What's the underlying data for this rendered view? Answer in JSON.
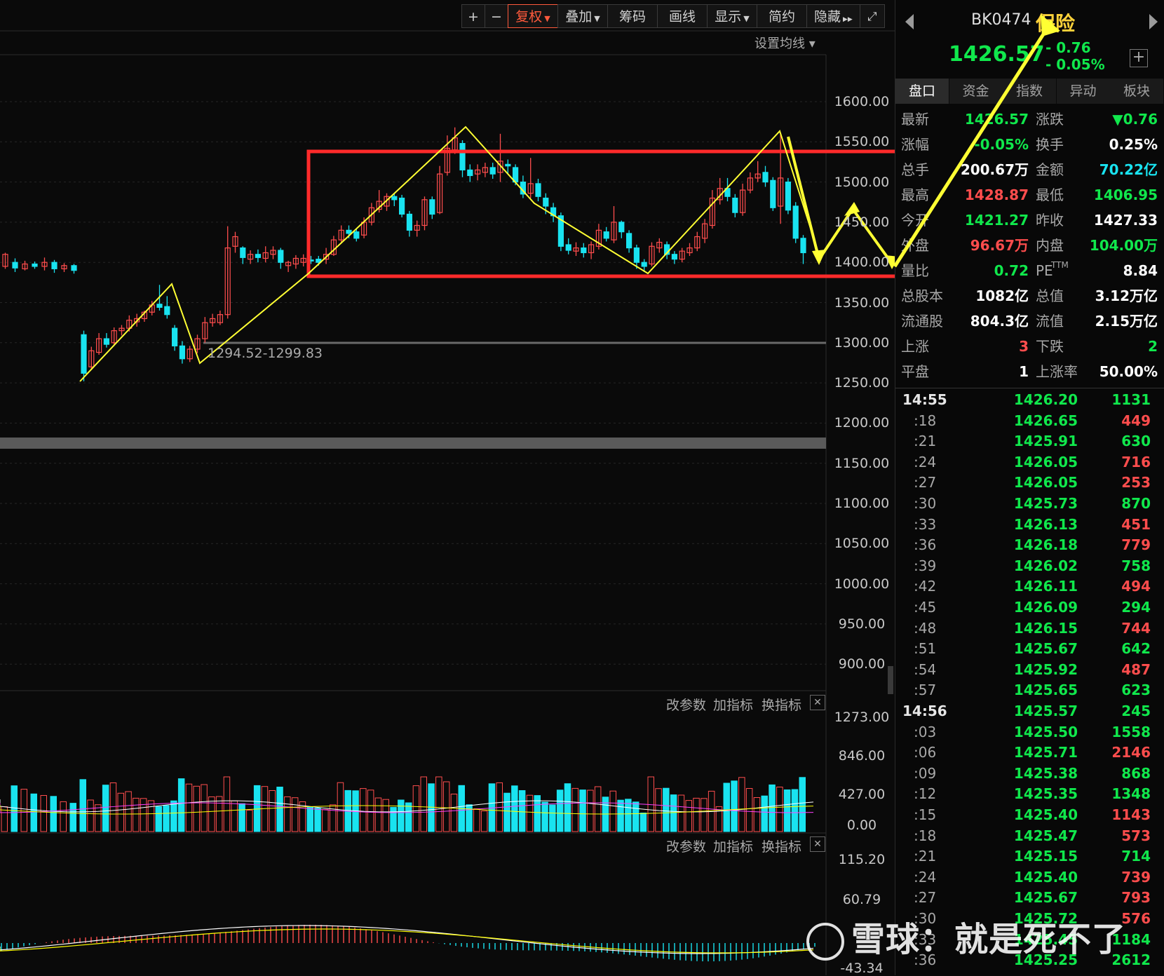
{
  "toolbar": {
    "plus": "+",
    "minus": "−",
    "items": [
      {
        "label": "复权",
        "has_menu": true,
        "active": true
      },
      {
        "label": "叠加",
        "has_menu": true,
        "active": false
      },
      {
        "label": "筹码",
        "has_menu": false,
        "active": false
      },
      {
        "label": "画线",
        "has_menu": false,
        "active": false
      },
      {
        "label": "显示",
        "has_menu": true,
        "active": false
      },
      {
        "label": "简约",
        "has_menu": false,
        "active": false
      },
      {
        "label": "隐藏",
        "has_menu": false,
        "active": false
      }
    ],
    "expand_icon": "expand-icon"
  },
  "ma_setting": "设置均线 ▾",
  "price_axis": [
    "1600.00",
    "1550.00",
    "1500.00",
    "1450.00",
    "1400.00",
    "1350.00",
    "1300.00",
    "1250.00",
    "1200.00",
    "1150.00",
    "1100.00",
    "1050.00",
    "1000.00",
    "950.00",
    "900.00"
  ],
  "support_label": "1294.52-1299.83",
  "volume_panel": {
    "buttons": [
      "改参数",
      "加指标",
      "换指标"
    ],
    "axis": [
      "1273.00",
      "846.00",
      "427.00",
      "0.00"
    ]
  },
  "macd_panel": {
    "buttons": [
      "改参数",
      "加指标",
      "换指标"
    ],
    "axis": [
      "115.20",
      "60.79",
      "",
      "-43.34"
    ]
  },
  "chart_data": {
    "type": "candlestick",
    "price_range": [
      1250,
      1600
    ],
    "candles": [
      {
        "o": 1395,
        "c": 1410,
        "h": 1412,
        "l": 1392
      },
      {
        "o": 1400,
        "c": 1393,
        "h": 1405,
        "l": 1388
      },
      {
        "o": 1392,
        "c": 1398,
        "h": 1402,
        "l": 1390
      },
      {
        "o": 1398,
        "c": 1395,
        "h": 1401,
        "l": 1392
      },
      {
        "o": 1395,
        "c": 1400,
        "h": 1406,
        "l": 1390
      },
      {
        "o": 1400,
        "c": 1392,
        "h": 1403,
        "l": 1387
      },
      {
        "o": 1392,
        "c": 1396,
        "h": 1399,
        "l": 1388
      },
      {
        "o": 1396,
        "c": 1390,
        "h": 1398,
        "l": 1386
      },
      {
        "o": 1310,
        "c": 1262,
        "h": 1315,
        "l": 1252
      },
      {
        "o": 1270,
        "c": 1290,
        "h": 1295,
        "l": 1266
      },
      {
        "o": 1288,
        "c": 1305,
        "h": 1312,
        "l": 1285
      },
      {
        "o": 1305,
        "c": 1298,
        "h": 1312,
        "l": 1294
      },
      {
        "o": 1300,
        "c": 1315,
        "h": 1319,
        "l": 1296
      },
      {
        "o": 1315,
        "c": 1318,
        "h": 1322,
        "l": 1309
      },
      {
        "o": 1318,
        "c": 1328,
        "h": 1334,
        "l": 1314
      },
      {
        "o": 1326,
        "c": 1330,
        "h": 1336,
        "l": 1320
      },
      {
        "o": 1330,
        "c": 1338,
        "h": 1340,
        "l": 1326
      },
      {
        "o": 1338,
        "c": 1347,
        "h": 1352,
        "l": 1334
      },
      {
        "o": 1348,
        "c": 1344,
        "h": 1372,
        "l": 1340
      },
      {
        "o": 1345,
        "c": 1335,
        "h": 1358,
        "l": 1330
      },
      {
        "o": 1318,
        "c": 1296,
        "h": 1322,
        "l": 1290
      },
      {
        "o": 1296,
        "c": 1280,
        "h": 1302,
        "l": 1274
      },
      {
        "o": 1280,
        "c": 1292,
        "h": 1296,
        "l": 1276
      },
      {
        "o": 1292,
        "c": 1305,
        "h": 1310,
        "l": 1287
      },
      {
        "o": 1305,
        "c": 1325,
        "h": 1332,
        "l": 1300
      },
      {
        "o": 1325,
        "c": 1330,
        "h": 1336,
        "l": 1320
      },
      {
        "o": 1325,
        "c": 1335,
        "h": 1340,
        "l": 1322
      },
      {
        "o": 1335,
        "c": 1418,
        "h": 1445,
        "l": 1330
      },
      {
        "o": 1420,
        "c": 1432,
        "h": 1438,
        "l": 1412
      },
      {
        "o": 1418,
        "c": 1406,
        "h": 1420,
        "l": 1398
      },
      {
        "o": 1404,
        "c": 1410,
        "h": 1415,
        "l": 1398
      },
      {
        "o": 1410,
        "c": 1406,
        "h": 1416,
        "l": 1400
      },
      {
        "o": 1405,
        "c": 1412,
        "h": 1420,
        "l": 1400
      },
      {
        "o": 1410,
        "c": 1415,
        "h": 1420,
        "l": 1404
      },
      {
        "o": 1415,
        "c": 1400,
        "h": 1418,
        "l": 1392
      },
      {
        "o": 1396,
        "c": 1400,
        "h": 1402,
        "l": 1388
      },
      {
        "o": 1398,
        "c": 1405,
        "h": 1409,
        "l": 1392
      },
      {
        "o": 1400,
        "c": 1405,
        "h": 1410,
        "l": 1395
      },
      {
        "o": 1403,
        "c": 1402,
        "h": 1408,
        "l": 1398
      },
      {
        "o": 1404,
        "c": 1400,
        "h": 1408,
        "l": 1396
      },
      {
        "o": 1404,
        "c": 1410,
        "h": 1418,
        "l": 1398
      },
      {
        "o": 1410,
        "c": 1428,
        "h": 1433,
        "l": 1408
      },
      {
        "o": 1428,
        "c": 1440,
        "h": 1446,
        "l": 1424
      },
      {
        "o": 1440,
        "c": 1436,
        "h": 1446,
        "l": 1430
      },
      {
        "o": 1438,
        "c": 1430,
        "h": 1442,
        "l": 1426
      },
      {
        "o": 1434,
        "c": 1450,
        "h": 1456,
        "l": 1430
      },
      {
        "o": 1450,
        "c": 1468,
        "h": 1474,
        "l": 1446
      },
      {
        "o": 1466,
        "c": 1476,
        "h": 1490,
        "l": 1462
      },
      {
        "o": 1470,
        "c": 1482,
        "h": 1486,
        "l": 1464
      },
      {
        "o": 1482,
        "c": 1478,
        "h": 1486,
        "l": 1470
      },
      {
        "o": 1480,
        "c": 1460,
        "h": 1484,
        "l": 1456
      },
      {
        "o": 1460,
        "c": 1440,
        "h": 1464,
        "l": 1432
      },
      {
        "o": 1440,
        "c": 1446,
        "h": 1452,
        "l": 1432
      },
      {
        "o": 1446,
        "c": 1478,
        "h": 1482,
        "l": 1440
      },
      {
        "o": 1478,
        "c": 1460,
        "h": 1482,
        "l": 1454
      },
      {
        "o": 1462,
        "c": 1510,
        "h": 1520,
        "l": 1460
      },
      {
        "o": 1512,
        "c": 1542,
        "h": 1558,
        "l": 1508
      },
      {
        "o": 1540,
        "c": 1555,
        "h": 1568,
        "l": 1535
      },
      {
        "o": 1548,
        "c": 1515,
        "h": 1552,
        "l": 1506
      },
      {
        "o": 1515,
        "c": 1508,
        "h": 1522,
        "l": 1500
      },
      {
        "o": 1510,
        "c": 1515,
        "h": 1522,
        "l": 1502
      },
      {
        "o": 1512,
        "c": 1518,
        "h": 1524,
        "l": 1506
      },
      {
        "o": 1518,
        "c": 1510,
        "h": 1524,
        "l": 1504
      },
      {
        "o": 1512,
        "c": 1526,
        "h": 1560,
        "l": 1500
      },
      {
        "o": 1522,
        "c": 1520,
        "h": 1528,
        "l": 1510
      },
      {
        "o": 1518,
        "c": 1500,
        "h": 1522,
        "l": 1496
      },
      {
        "o": 1500,
        "c": 1485,
        "h": 1508,
        "l": 1480
      },
      {
        "o": 1486,
        "c": 1498,
        "h": 1530,
        "l": 1480
      },
      {
        "o": 1498,
        "c": 1482,
        "h": 1504,
        "l": 1476
      },
      {
        "o": 1480,
        "c": 1470,
        "h": 1486,
        "l": 1460
      },
      {
        "o": 1468,
        "c": 1458,
        "h": 1474,
        "l": 1450
      },
      {
        "o": 1458,
        "c": 1420,
        "h": 1462,
        "l": 1414
      },
      {
        "o": 1422,
        "c": 1415,
        "h": 1430,
        "l": 1410
      },
      {
        "o": 1414,
        "c": 1418,
        "h": 1425,
        "l": 1408
      },
      {
        "o": 1418,
        "c": 1412,
        "h": 1424,
        "l": 1406
      },
      {
        "o": 1412,
        "c": 1422,
        "h": 1426,
        "l": 1404
      },
      {
        "o": 1420,
        "c": 1440,
        "h": 1448,
        "l": 1416
      },
      {
        "o": 1438,
        "c": 1430,
        "h": 1444,
        "l": 1426
      },
      {
        "o": 1428,
        "c": 1450,
        "h": 1470,
        "l": 1424
      },
      {
        "o": 1450,
        "c": 1438,
        "h": 1452,
        "l": 1430
      },
      {
        "o": 1436,
        "c": 1418,
        "h": 1440,
        "l": 1412
      },
      {
        "o": 1418,
        "c": 1400,
        "h": 1422,
        "l": 1392
      },
      {
        "o": 1400,
        "c": 1395,
        "h": 1404,
        "l": 1388
      },
      {
        "o": 1398,
        "c": 1420,
        "h": 1425,
        "l": 1395
      },
      {
        "o": 1418,
        "c": 1425,
        "h": 1430,
        "l": 1412
      },
      {
        "o": 1422,
        "c": 1410,
        "h": 1426,
        "l": 1404
      },
      {
        "o": 1410,
        "c": 1404,
        "h": 1414,
        "l": 1398
      },
      {
        "o": 1404,
        "c": 1414,
        "h": 1418,
        "l": 1400
      },
      {
        "o": 1412,
        "c": 1418,
        "h": 1424,
        "l": 1408
      },
      {
        "o": 1418,
        "c": 1432,
        "h": 1438,
        "l": 1414
      },
      {
        "o": 1430,
        "c": 1448,
        "h": 1454,
        "l": 1424
      },
      {
        "o": 1446,
        "c": 1480,
        "h": 1490,
        "l": 1442
      },
      {
        "o": 1478,
        "c": 1492,
        "h": 1505,
        "l": 1472
      },
      {
        "o": 1492,
        "c": 1482,
        "h": 1505,
        "l": 1476
      },
      {
        "o": 1480,
        "c": 1462,
        "h": 1485,
        "l": 1456
      },
      {
        "o": 1462,
        "c": 1490,
        "h": 1498,
        "l": 1458
      },
      {
        "o": 1490,
        "c": 1505,
        "h": 1512,
        "l": 1486
      },
      {
        "o": 1505,
        "c": 1510,
        "h": 1526,
        "l": 1500
      },
      {
        "o": 1512,
        "c": 1500,
        "h": 1520,
        "l": 1494
      },
      {
        "o": 1502,
        "c": 1468,
        "h": 1506,
        "l": 1464
      },
      {
        "o": 1470,
        "c": 1505,
        "h": 1560,
        "l": 1448
      },
      {
        "o": 1500,
        "c": 1465,
        "h": 1505,
        "l": 1460
      },
      {
        "o": 1470,
        "c": 1430,
        "h": 1475,
        "l": 1424
      },
      {
        "o": 1430,
        "c": 1412,
        "h": 1434,
        "l": 1398
      }
    ]
  },
  "panel": {
    "code": "BK0474",
    "name": "保险",
    "price": "1426.57",
    "change": "- 0.76",
    "change_pct": "- 0.05%",
    "add_icon": "plus-box-icon",
    "tabs": [
      "盘口",
      "资金",
      "指数",
      "异动",
      "板块"
    ],
    "quote": [
      [
        "最新",
        "1426.57",
        "green",
        "涨跌",
        "▼0.76",
        "green"
      ],
      [
        "涨幅",
        "-0.05%",
        "green",
        "换手",
        "0.25%",
        "white"
      ],
      [
        "总手",
        "200.67万",
        "white",
        "金额",
        "70.22亿",
        "cyan"
      ],
      [
        "最高",
        "1428.87",
        "red",
        "最低",
        "1406.95",
        "green"
      ],
      [
        "今开",
        "1421.27",
        "green",
        "昨收",
        "1427.33",
        "white"
      ],
      [
        "外盘",
        "96.67万",
        "red",
        "内盘",
        "104.00万",
        "green"
      ],
      [
        "量比",
        "0.72",
        "green",
        "PE",
        "8.84",
        "white"
      ],
      [
        "总股本",
        "1082亿",
        "white",
        "总值",
        "3.12万亿",
        "white"
      ],
      [
        "流通股",
        "804.3亿",
        "white",
        "流值",
        "2.15万亿",
        "white"
      ],
      [
        "上涨",
        "3",
        "red",
        "下跌",
        "2",
        "green"
      ],
      [
        "平盘",
        "1",
        "white",
        "上涨率",
        "50.00%",
        "white"
      ]
    ],
    "pe_sup": "TTM",
    "ticks": [
      {
        "t": "14:55",
        "p": "1426.20",
        "v": "1131",
        "c": "green",
        "major": true
      },
      {
        "t": ":18",
        "p": "1426.65",
        "v": "449",
        "c": "red"
      },
      {
        "t": ":21",
        "p": "1425.91",
        "v": "630",
        "c": "green"
      },
      {
        "t": ":24",
        "p": "1426.05",
        "v": "716",
        "c": "red"
      },
      {
        "t": ":27",
        "p": "1426.05",
        "v": "253",
        "c": "red"
      },
      {
        "t": ":30",
        "p": "1425.73",
        "v": "870",
        "c": "green"
      },
      {
        "t": ":33",
        "p": "1426.13",
        "v": "451",
        "c": "red"
      },
      {
        "t": ":36",
        "p": "1426.18",
        "v": "779",
        "c": "red"
      },
      {
        "t": ":39",
        "p": "1426.02",
        "v": "758",
        "c": "green"
      },
      {
        "t": ":42",
        "p": "1426.11",
        "v": "494",
        "c": "red"
      },
      {
        "t": ":45",
        "p": "1426.09",
        "v": "294",
        "c": "green"
      },
      {
        "t": ":48",
        "p": "1426.15",
        "v": "744",
        "c": "red"
      },
      {
        "t": ":51",
        "p": "1425.67",
        "v": "642",
        "c": "green"
      },
      {
        "t": ":54",
        "p": "1425.92",
        "v": "487",
        "c": "red"
      },
      {
        "t": ":57",
        "p": "1425.65",
        "v": "623",
        "c": "green"
      },
      {
        "t": "14:56",
        "p": "1425.57",
        "v": "245",
        "c": "green",
        "major": true
      },
      {
        "t": ":03",
        "p": "1425.50",
        "v": "1558",
        "c": "green"
      },
      {
        "t": ":06",
        "p": "1425.71",
        "v": "2146",
        "c": "red"
      },
      {
        "t": ":09",
        "p": "1425.38",
        "v": "868",
        "c": "green"
      },
      {
        "t": ":12",
        "p": "1425.35",
        "v": "1348",
        "c": "green"
      },
      {
        "t": ":15",
        "p": "1425.40",
        "v": "1143",
        "c": "red"
      },
      {
        "t": ":18",
        "p": "1425.47",
        "v": "573",
        "c": "red"
      },
      {
        "t": ":21",
        "p": "1425.15",
        "v": "714",
        "c": "green"
      },
      {
        "t": ":24",
        "p": "1425.40",
        "v": "739",
        "c": "red"
      },
      {
        "t": ":27",
        "p": "1425.67",
        "v": "793",
        "c": "red"
      },
      {
        "t": ":30",
        "p": "1425.72",
        "v": "576",
        "c": "red"
      },
      {
        "t": ":33",
        "p": "1425.45",
        "v": "1184",
        "c": "green"
      },
      {
        "t": ":36",
        "p": "1425.25",
        "v": "2612",
        "c": "green"
      }
    ]
  },
  "watermark": "雪球：就是死不了",
  "colors": {
    "up": "#ff4d4d",
    "down": "#19e3f0",
    "annotation": "#ffff00",
    "box": "#ff2a2a",
    "green": "#10e84c"
  }
}
